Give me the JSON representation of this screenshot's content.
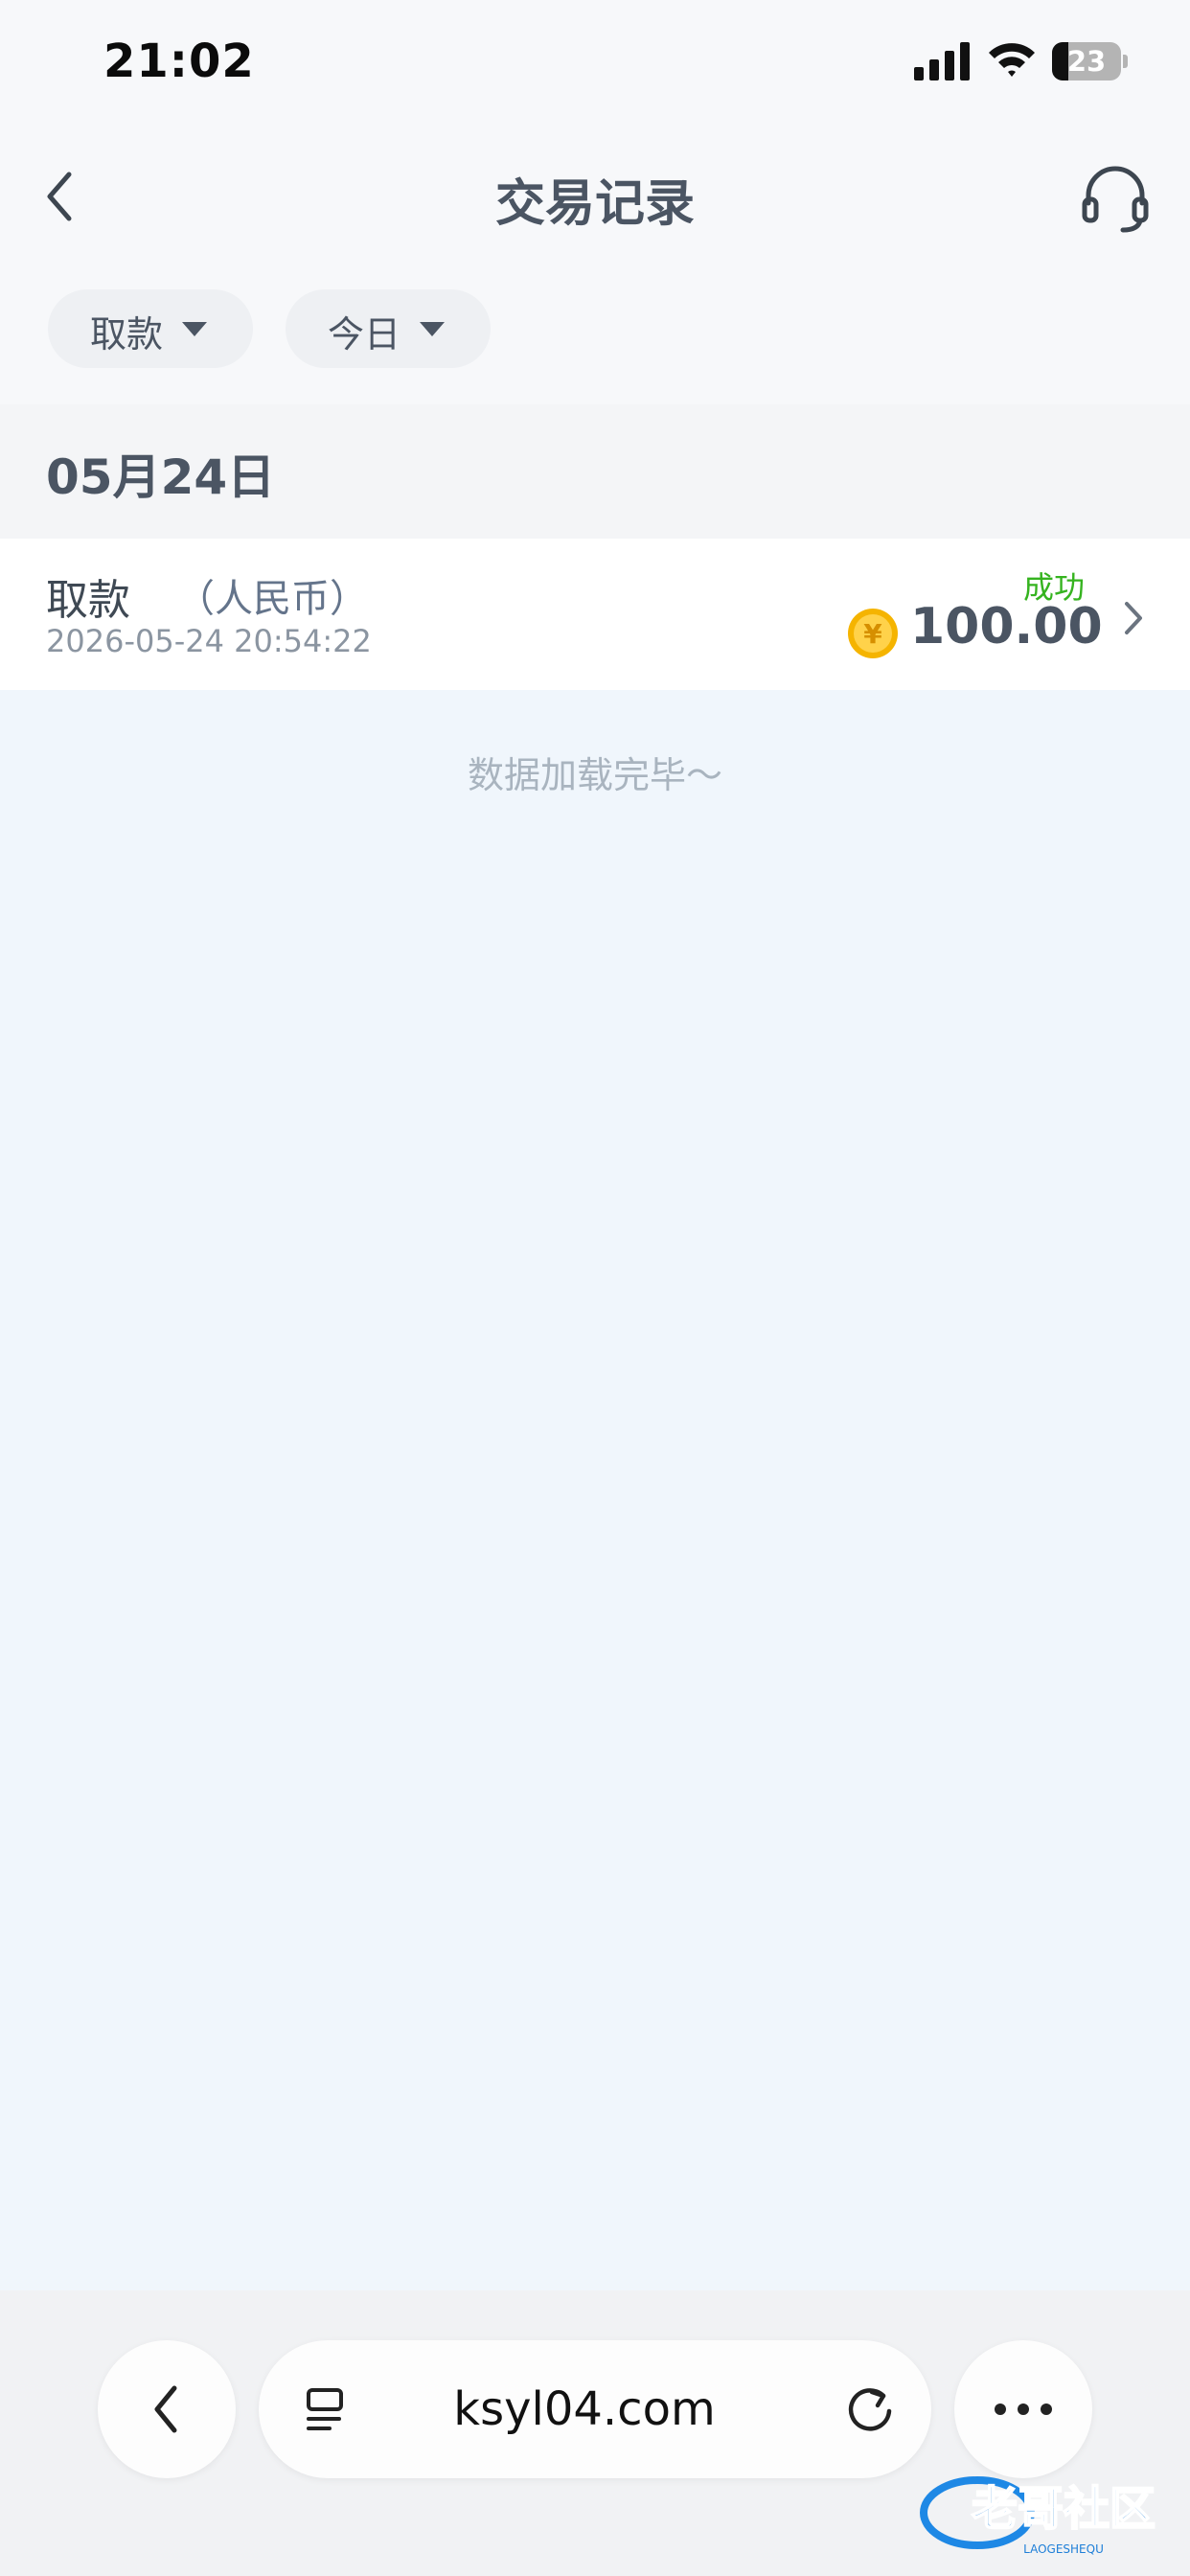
{
  "status_bar": {
    "time": "21:02",
    "battery_level": "23"
  },
  "header": {
    "title": "交易记录"
  },
  "filters": [
    {
      "label": "取款"
    },
    {
      "label": "今日"
    }
  ],
  "sections": [
    {
      "date": "05月24日",
      "transactions": [
        {
          "type": "取款",
          "currency": "（人民币）",
          "datetime": "2026-05-24 20:54:22",
          "status": "成功",
          "amount": "100.00",
          "coin_symbol": "¥"
        }
      ]
    }
  ],
  "footer_text": "数据加载完毕～",
  "browser": {
    "url": "ksyl04.com"
  },
  "watermark": {
    "text": "老哥社区",
    "subtext": "LAOGESHEQU"
  },
  "colors": {
    "success": "#35b31f",
    "coin": "#f5b400",
    "page_background": "#f0f6fc"
  }
}
